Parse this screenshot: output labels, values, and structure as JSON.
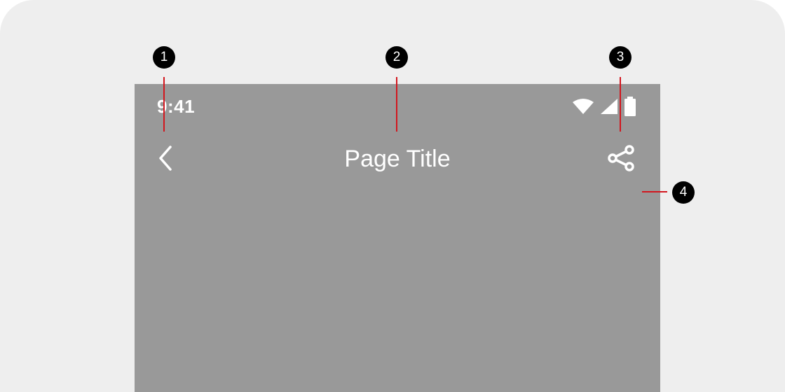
{
  "status_bar": {
    "time": "9:41",
    "icons": [
      "wifi-icon",
      "cellular-signal-icon",
      "battery-icon"
    ]
  },
  "top_app_bar": {
    "title": "Page Title",
    "leading_icon": "chevron-left-icon",
    "trailing_icon": "share-icon"
  },
  "callouts": [
    {
      "number": "1"
    },
    {
      "number": "2"
    },
    {
      "number": "3"
    },
    {
      "number": "4"
    }
  ],
  "colors": {
    "background": "#eeeeee",
    "device_surface": "#999999",
    "foreground": "#ffffff",
    "callout_line": "#d2161e",
    "callout_badge": "#000000"
  }
}
